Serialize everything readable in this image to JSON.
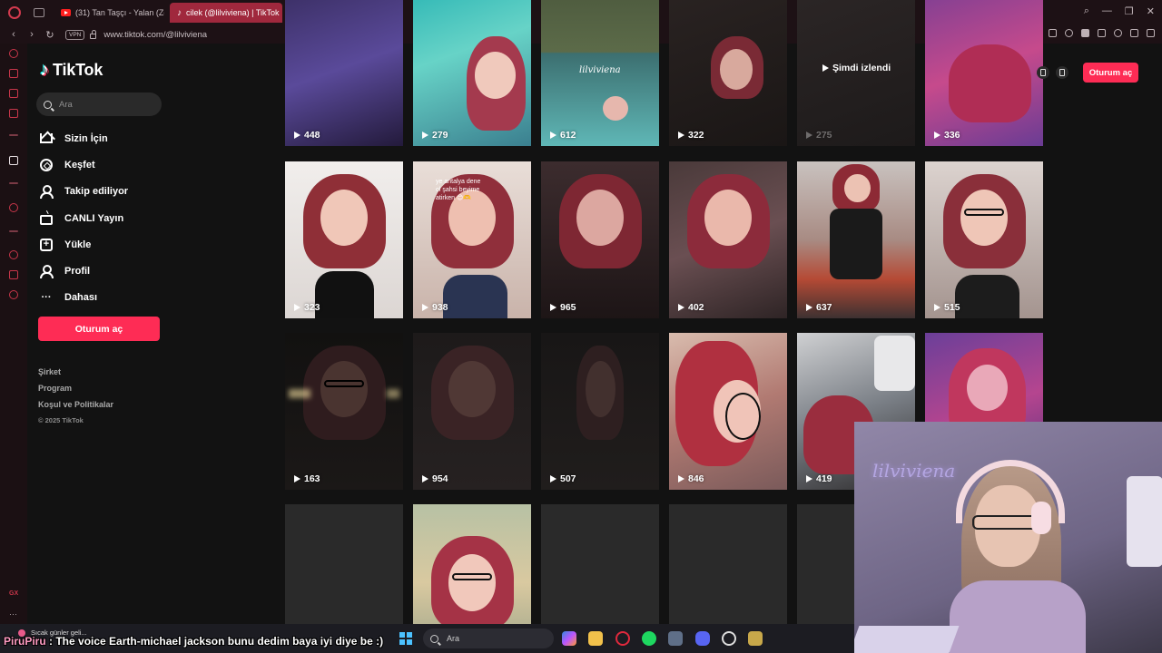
{
  "browser": {
    "tabs": [
      {
        "label": "(31) Tan Taşçı - Yalan (Ze"
      },
      {
        "label": "cilek (@lilviviena) | TikTok"
      }
    ],
    "url": "www.tiktok.com/@lilviviena",
    "vpn_label": "VPN"
  },
  "tiktok": {
    "brand": "TikTok",
    "search_placeholder": "Ara",
    "menu": [
      {
        "label": "Sizin İçin",
        "icon": "home-icon"
      },
      {
        "label": "Keşfet",
        "icon": "compass-icon"
      },
      {
        "label": "Takip ediliyor",
        "icon": "following-icon"
      },
      {
        "label": "CANLI Yayın",
        "icon": "live-icon"
      },
      {
        "label": "Yükle",
        "icon": "upload-icon"
      },
      {
        "label": "Profil",
        "icon": "profile-icon"
      },
      {
        "label": "Dahası",
        "icon": "more-icon"
      }
    ],
    "signin_label": "Oturum aç",
    "footer": {
      "company": "Şirket",
      "program": "Program",
      "terms": "Koşul ve Politikalar",
      "copyright": "© 2025 TikTok"
    },
    "top_signin_label": "Oturum aç",
    "accent_color": "#fe2c55"
  },
  "grid": {
    "rows": [
      [
        {
          "count": "448",
          "caption": ""
        },
        {
          "count": "279",
          "caption": ""
        },
        {
          "count": "612",
          "caption": "lilviviena"
        },
        {
          "count": "322",
          "caption": ""
        },
        {
          "count": "275",
          "caption": "Şimdi izlendi"
        },
        {
          "count": "336",
          "caption": ""
        }
      ],
      [
        {
          "count": "323"
        },
        {
          "count": "938",
          "caption": "ye antalya dene\nol şahsi beyime\natirken 😊🫶"
        },
        {
          "count": "965"
        },
        {
          "count": "402"
        },
        {
          "count": "637"
        },
        {
          "count": "515"
        }
      ],
      [
        {
          "count": "163"
        },
        {
          "count": "954"
        },
        {
          "count": "507"
        },
        {
          "count": "846"
        },
        {
          "count": "419"
        },
        {
          "count": ""
        }
      ],
      [
        {
          "count": ""
        },
        {
          "count": ""
        },
        {
          "count": ""
        },
        {
          "count": ""
        },
        {
          "count": ""
        },
        {
          "count": ""
        }
      ]
    ]
  },
  "taskbar": {
    "weather": "Sıcak günler geli...",
    "search_label": "Ara",
    "chat_user": "PiruPiru",
    "chat_message": " : The voice Earth-michael jackson bunu dedim baya iyi diye be :)"
  },
  "opera_sidebar": {
    "gx_label": "GX",
    "more_label": "···"
  }
}
